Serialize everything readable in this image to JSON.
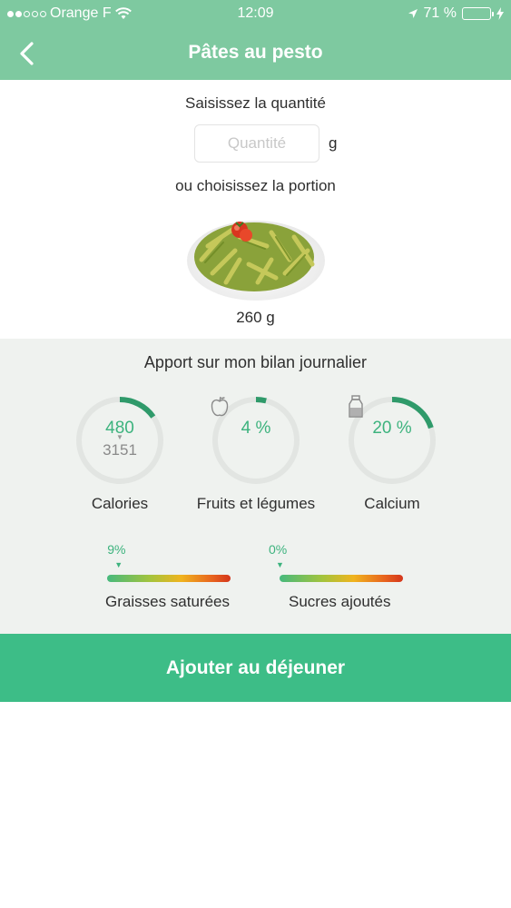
{
  "status_bar": {
    "carrier": "Orange F",
    "time": "12:09",
    "battery_percent": "71 %",
    "battery_level": 0.71
  },
  "nav": {
    "title": "Pâtes au pesto",
    "back_icon": "chevron-left-icon"
  },
  "quantity": {
    "prompt": "Saisissez la quantité",
    "input_value": "",
    "input_placeholder": "Quantité",
    "unit": "g"
  },
  "portion": {
    "prompt": "ou choisissez la portion",
    "image_icon": "pasta-pesto-photo",
    "weight": "260 g"
  },
  "intake": {
    "title": "Apport sur mon bilan journalier",
    "gauges": [
      {
        "value": "480",
        "sub": "3151",
        "label": "Calories",
        "fraction": 0.152,
        "icon": ""
      },
      {
        "value": "4 %",
        "sub": "",
        "label": "Fruits et légumes",
        "fraction": 0.04,
        "icon": "apple-icon"
      },
      {
        "value": "20 %",
        "sub": "",
        "label": "Calcium",
        "fraction": 0.2,
        "icon": "milk-bottle-icon"
      }
    ],
    "bars": [
      {
        "percent": "9%",
        "fraction": 0.09,
        "label": "Graisses saturées"
      },
      {
        "percent": "0%",
        "fraction": 0.0,
        "label": "Sucres ajoutés"
      }
    ]
  },
  "action": {
    "label": "Ajouter au déjeuner"
  },
  "colors": {
    "header": "#7ec9a0",
    "accent": "#3db37e",
    "button": "#3dbd87",
    "gauge_track": "#e2e5e2",
    "gauge_progress": "#2f9a6a",
    "panel_bg": "#eff2ef"
  }
}
